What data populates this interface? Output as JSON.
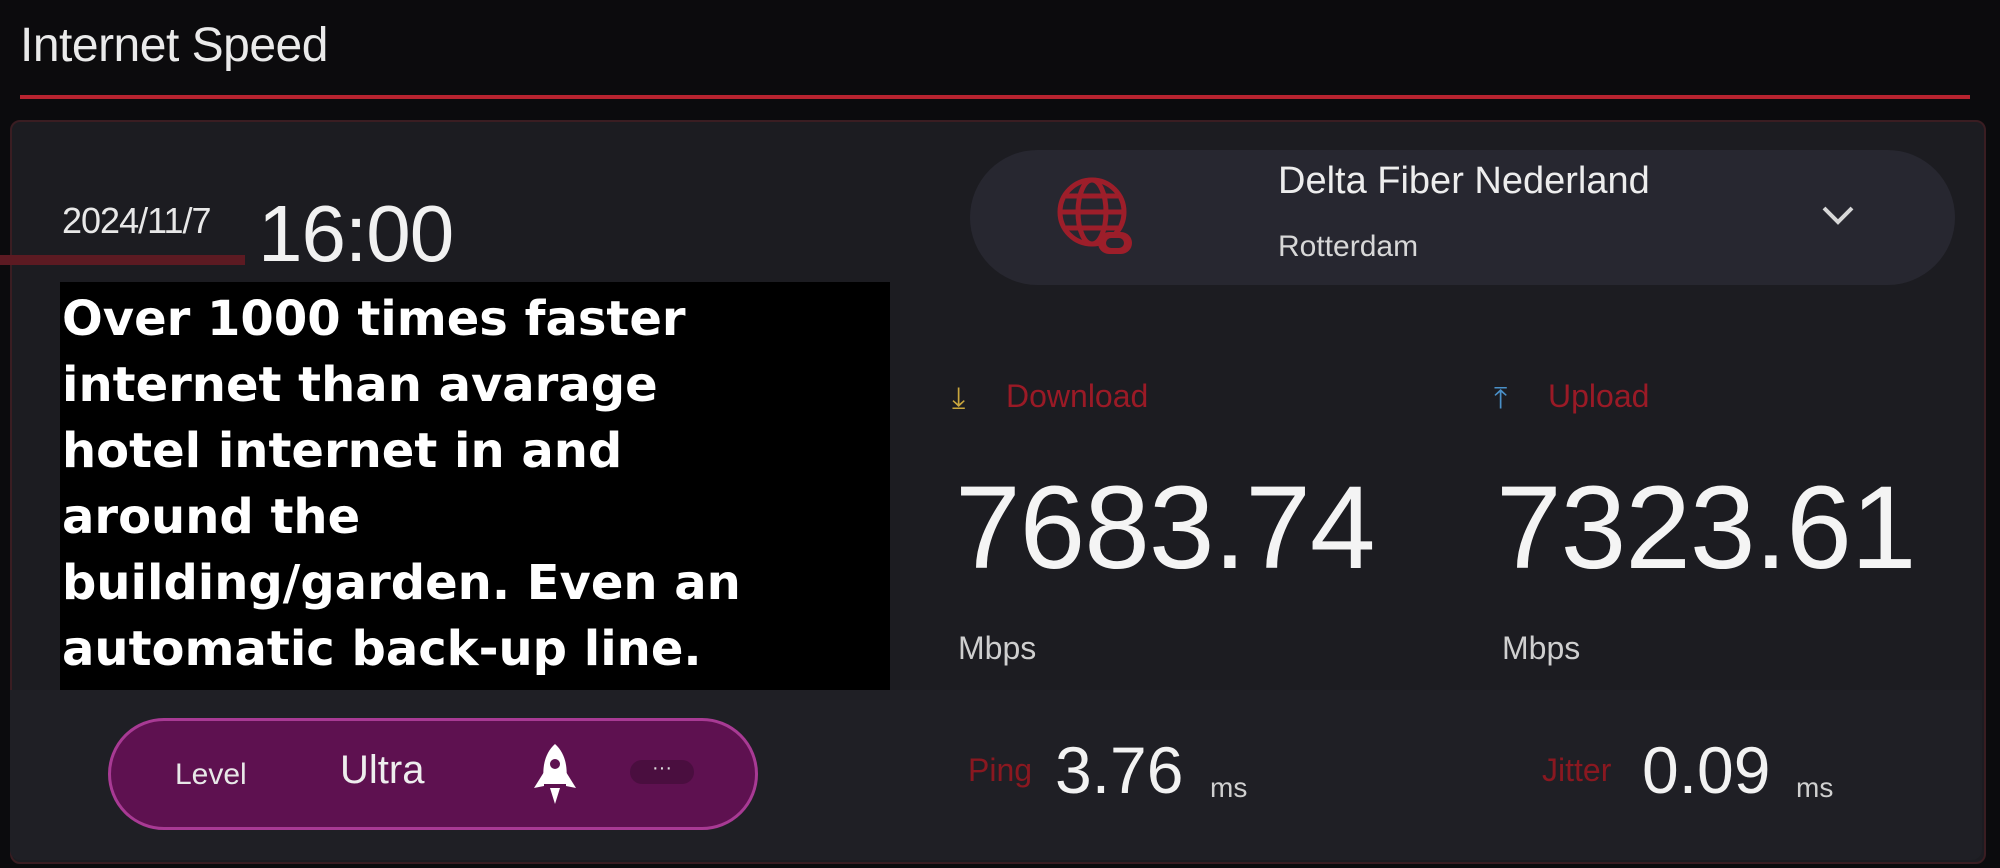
{
  "header": {
    "title": "Internet Speed"
  },
  "timestamp": {
    "date": "2024/11/7",
    "time": "16:00"
  },
  "overlay": {
    "text": "Over 1000 times faster\ninternet than avarage\nhotel internet in and\naround the\nbuilding/garden. Even an\nautomatic back-up line."
  },
  "isp": {
    "name": "Delta Fiber Nederland",
    "city": "Rotterdam",
    "icon": "globe-link-icon"
  },
  "download": {
    "label": "Download",
    "value": "7683.74",
    "unit": "Mbps",
    "icon": "download-arrow-icon"
  },
  "upload": {
    "label": "Upload",
    "value": "7323.61",
    "unit": "Mbps",
    "icon": "upload-arrow-icon"
  },
  "level": {
    "label": "Level",
    "value": "Ultra",
    "more": "···",
    "icon": "rocket-icon"
  },
  "ping": {
    "label": "Ping",
    "value": "3.76",
    "unit": "ms"
  },
  "jitter": {
    "label": "Jitter",
    "value": "0.09",
    "unit": "ms"
  },
  "colors": {
    "accent": "#b8232f",
    "level_pill": "#5e1150",
    "panel": "#1c1c21"
  }
}
